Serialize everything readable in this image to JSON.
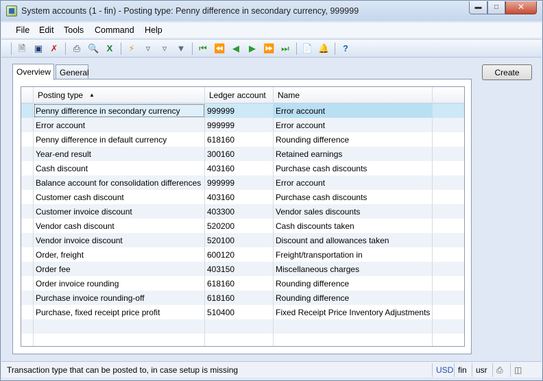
{
  "window": {
    "title": "System accounts (1 - fin) - Posting type: Penny difference in secondary currency, 999999"
  },
  "menu": [
    "File",
    "Edit",
    "Tools",
    "Command",
    "Help"
  ],
  "tabs": [
    "Overview",
    "General"
  ],
  "buttons": {
    "create": "Create"
  },
  "grid": {
    "columns": [
      "Posting type",
      "Ledger account",
      "Name"
    ],
    "rows": [
      [
        "Penny difference in secondary currency",
        "999999",
        "Error account"
      ],
      [
        "Error account",
        "999999",
        "Error account"
      ],
      [
        "Penny difference in default currency",
        "618160",
        "Rounding difference"
      ],
      [
        "Year-end result",
        "300160",
        "Retained earnings"
      ],
      [
        "Cash discount",
        "403160",
        "Purchase cash discounts"
      ],
      [
        "Balance account for consolidation differences",
        "999999",
        "Error account"
      ],
      [
        "Customer cash discount",
        "403160",
        "Purchase cash discounts"
      ],
      [
        "Customer invoice discount",
        "403300",
        "Vendor sales discounts"
      ],
      [
        "Vendor cash discount",
        "520200",
        "Cash discounts taken"
      ],
      [
        "Vendor invoice discount",
        "520100",
        "Discount and allowances taken"
      ],
      [
        "Order, freight",
        "600120",
        "Freight/transportation in"
      ],
      [
        "Order fee",
        "403150",
        "Miscellaneous charges"
      ],
      [
        "Order invoice rounding",
        "618160",
        "Rounding difference"
      ],
      [
        "Purchase invoice rounding-off",
        "618160",
        "Rounding difference"
      ],
      [
        "Purchase, fixed receipt price profit",
        "510400",
        "Fixed Receipt Price Inventory Adjustments"
      ]
    ]
  },
  "status": {
    "message": "Transaction type that can be posted to, in case setup is missing",
    "currency": "USD",
    "company": "fin",
    "user": "usr"
  },
  "icons": {
    "toolbar": [
      "new-icon",
      "save-icon",
      "delete-icon",
      "print-icon",
      "print-preview-icon",
      "export-excel-icon",
      "filter-by-selection-icon",
      "filter-by-grid-icon",
      "advanced-filter-icon",
      "remove-filter-icon",
      "first-record-icon",
      "previous-page-icon",
      "previous-record-icon",
      "next-record-icon",
      "next-page-icon",
      "last-record-icon",
      "attachments-icon",
      "alerts-icon",
      "help-icon"
    ]
  }
}
